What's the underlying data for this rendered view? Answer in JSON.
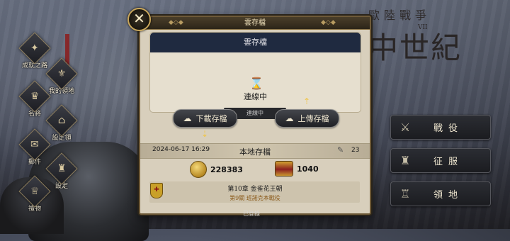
{
  "title": {
    "top": "歐陸戰爭",
    "numeral": "VII",
    "big": "中世紀"
  },
  "side_menu": [
    {
      "icon": "✦",
      "label": "成就之路"
    },
    {
      "icon": "⚜",
      "label": "我的領地"
    },
    {
      "icon": "♛",
      "label": "名將"
    },
    {
      "icon": "⌂",
      "label": "設定領"
    },
    {
      "icon": "✉",
      "label": "郵件"
    },
    {
      "icon": "♜",
      "label": "設定"
    },
    {
      "icon": "♕",
      "label": "禮物"
    }
  ],
  "right_menu": [
    {
      "icon": "⚔",
      "label": "戰役"
    },
    {
      "icon": "♜",
      "label": "征服"
    },
    {
      "icon": "♖",
      "label": "領地"
    }
  ],
  "dialog": {
    "header": "雲存檔",
    "close": "✕",
    "cloud_title": "雲存檔",
    "sync_icon": "⌛",
    "cloud_status": "連線中",
    "sync_bar": "連線中",
    "download_icon": "☁",
    "download_label": "下載存檔",
    "upload_icon": "☁",
    "upload_label": "上傳存檔",
    "arrow_up": "⇡",
    "arrow_down": "⇣",
    "local": {
      "date": "2024-06-17 16:29",
      "title": "本地存檔",
      "chat_icon": "✎",
      "count": "23"
    },
    "gold": "228383",
    "chest": "1040",
    "shield_icon": "✚",
    "chapter": "第10章 金雀花王朝",
    "battle": "第9關 班諾克本戰役"
  },
  "footer_hint": "已登錄"
}
